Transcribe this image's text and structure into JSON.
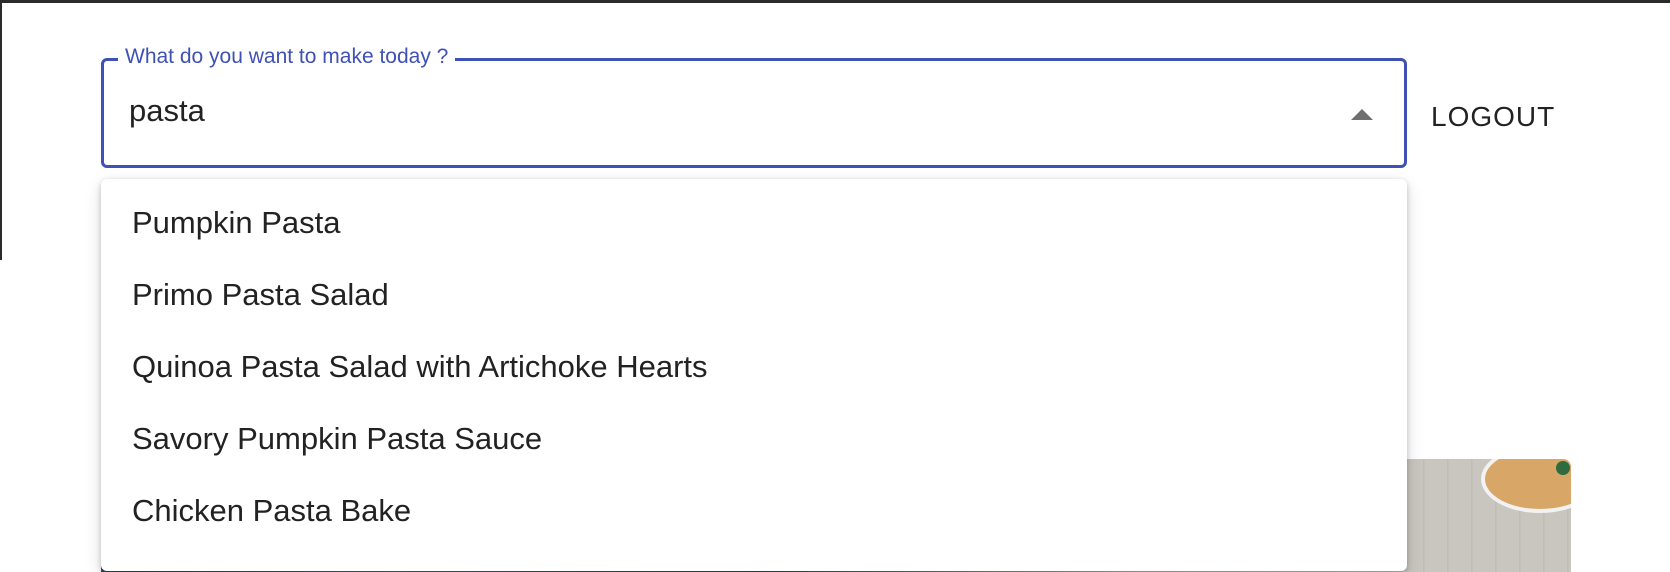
{
  "search": {
    "label": "What do you want to make today ?",
    "value": "pasta",
    "caret_icon": "arrow-drop-up-icon"
  },
  "header": {
    "logout_label": "LOGOUT"
  },
  "dropdown": {
    "options": [
      {
        "label": "Pumpkin Pasta"
      },
      {
        "label": "Primo Pasta Salad"
      },
      {
        "label": "Quinoa Pasta Salad with Artichoke Hearts"
      },
      {
        "label": "Savory Pumpkin Pasta Sauce"
      },
      {
        "label": "Chicken Pasta Bake"
      }
    ]
  },
  "colors": {
    "accent": "#3f51b5",
    "text": "#222222",
    "caret": "#6f6f6f"
  }
}
